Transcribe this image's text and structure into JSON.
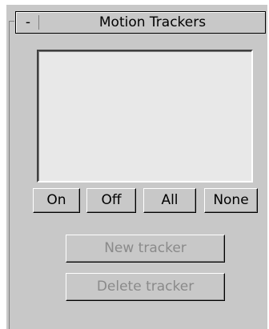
{
  "rollout": {
    "toggle_symbol": "-",
    "title": "Motion Trackers"
  },
  "tracker_list": {
    "items": []
  },
  "visibility_buttons": {
    "on": "On",
    "off": "Off",
    "all": "All",
    "none": "None"
  },
  "actions": {
    "new_tracker": "New tracker",
    "new_tracker_enabled": false,
    "delete_tracker": "Delete tracker",
    "delete_tracker_enabled": false
  },
  "colors": {
    "panel_background": "#c8c8c8",
    "list_background": "#e8e8e8",
    "disabled_text": "#8a8a8a"
  }
}
